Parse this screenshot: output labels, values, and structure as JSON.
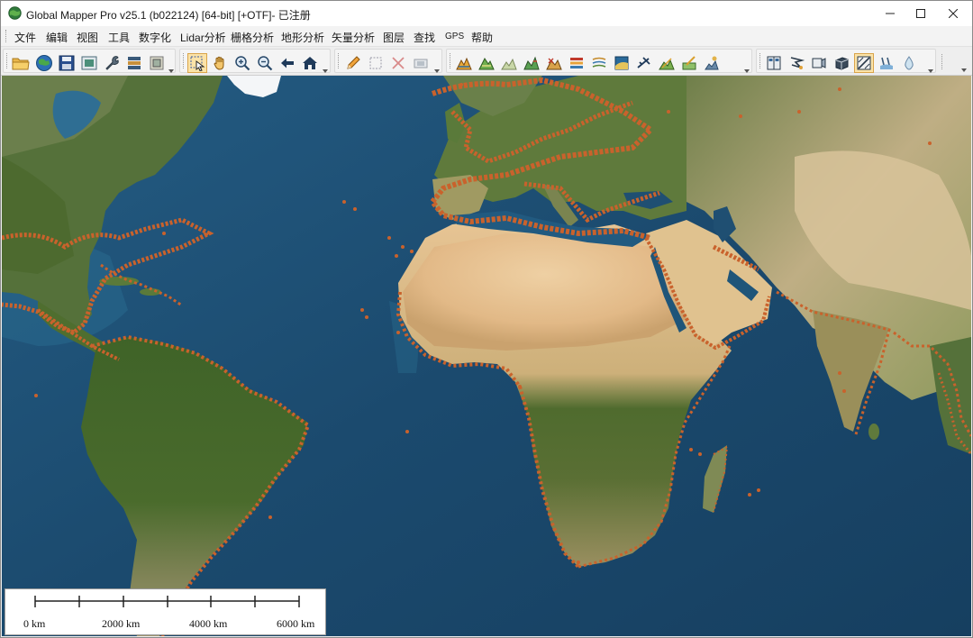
{
  "window": {
    "title": "Global Mapper Pro v25.1 (b022124) [64-bit] [+OTF]- 已注册",
    "controls": [
      "minimize-icon",
      "maximize-icon",
      "close-icon"
    ]
  },
  "menu": {
    "items": [
      "文件",
      "编辑",
      "视图",
      "工具",
      "数字化",
      "Lidar分析",
      "栅格分析",
      "地形分析",
      "矢量分析",
      "图层",
      "查找",
      "GPS",
      "帮助"
    ]
  },
  "toolbar": {
    "group1": [
      "open-folder-icon",
      "globe-icon",
      "save-icon",
      "image-export-icon",
      "wrench-icon",
      "layers-icon",
      "overlay-control-icon"
    ],
    "group2": [
      "digitizer-pointer-icon",
      "pan-hand-icon",
      "zoom-in-icon",
      "zoom-out-icon",
      "back-arrow-icon",
      "home-icon"
    ],
    "group3": [
      "pencil-icon",
      "select-box-icon",
      "delete-x-icon",
      "measure-icon"
    ],
    "group4": [
      "terrain-1-icon",
      "terrain-2-icon",
      "terrain-3-icon",
      "terrain-4-icon",
      "terrain-5-icon",
      "terrain-6-icon",
      "terrain-7-icon",
      "terrain-8-icon",
      "terrain-9-icon",
      "terrain-10-icon",
      "terrain-11-icon",
      "terrain-12-icon"
    ],
    "group5": [
      "split-view-icon",
      "path-profile-icon",
      "view-3d-icon",
      "three-d-cube-icon",
      "shader-icon",
      "water-level-icon",
      "water-drop-icon"
    ],
    "active": "shader-icon",
    "colors": {
      "accent": "#d9a44a",
      "active_bg": "#fbe3a8"
    }
  },
  "map": {
    "basemap": "satellite-imagery",
    "feature_color": "#c9622c",
    "ocean_color": "#1f5278"
  },
  "scale_bar": {
    "labels": [
      "0 km",
      "2000 km",
      "4000 km",
      "6000 km"
    ]
  }
}
